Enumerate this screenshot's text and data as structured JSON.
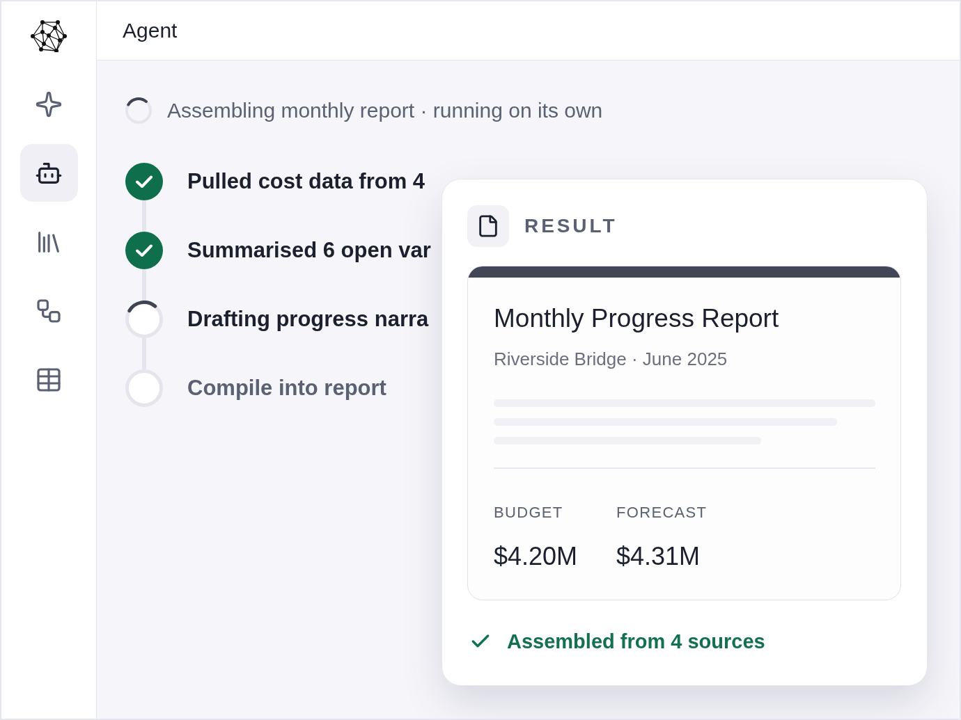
{
  "header": {
    "title": "Agent"
  },
  "sidebar": {
    "items": [
      {
        "selected": false
      },
      {
        "selected": true
      },
      {
        "selected": false
      },
      {
        "selected": false
      },
      {
        "selected": false
      }
    ]
  },
  "run_status": {
    "text": "Assembling monthly report · running on its own",
    "running": true
  },
  "steps": [
    {
      "label": "Pulled cost data from 4",
      "completed": true,
      "in_progress": false
    },
    {
      "label": "Summarised 6 open var",
      "completed": true,
      "in_progress": false
    },
    {
      "label": "Drafting progress narra",
      "completed": false,
      "in_progress": true
    },
    {
      "label": "Compile into report",
      "completed": false,
      "in_progress": false
    }
  ],
  "result": {
    "heading": "RESULT",
    "report": {
      "title": "Monthly Progress Report",
      "subtitle": "Riverside Bridge · June 2025",
      "metrics": [
        {
          "label": "BUDGET",
          "value": "$4.20M"
        },
        {
          "label": "FORECAST",
          "value": "$4.31M"
        }
      ]
    },
    "footer": {
      "text": "Assembled from 4 sources"
    }
  }
}
